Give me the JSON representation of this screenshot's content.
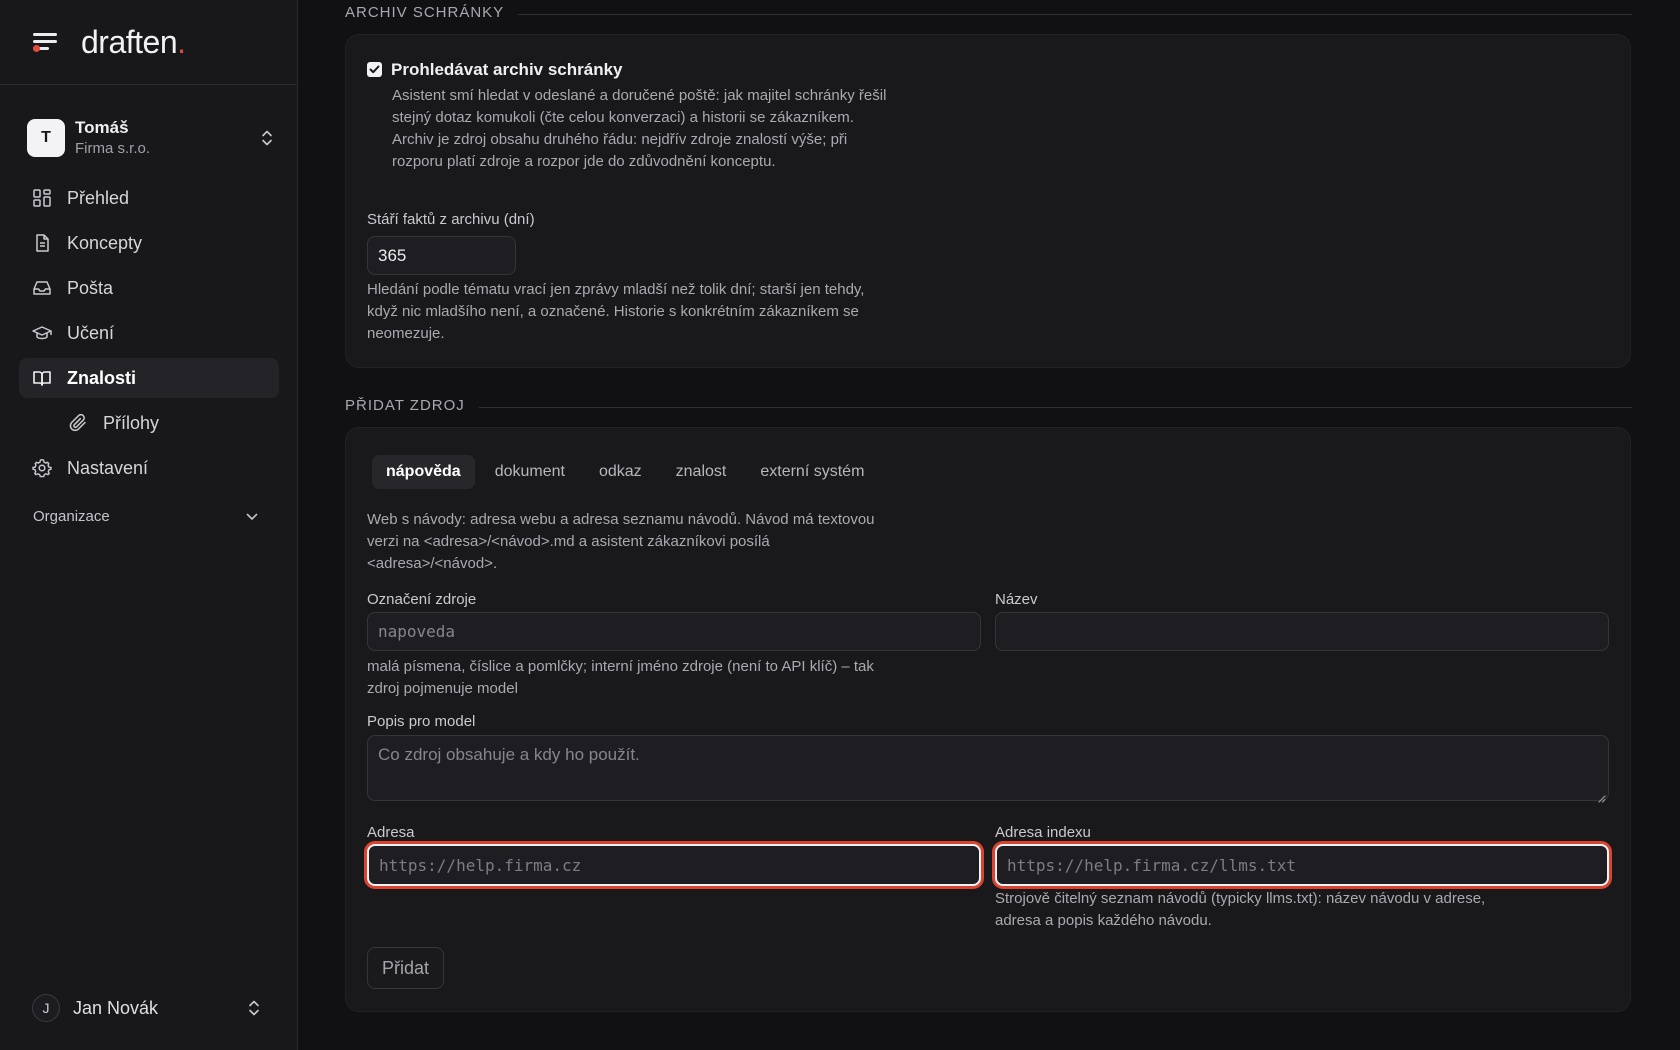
{
  "app": {
    "logo_text": "draften",
    "logo_dot": "."
  },
  "account": {
    "initial": "T",
    "name": "Tomáš",
    "company": "Firma s.r.o."
  },
  "nav": {
    "items": [
      {
        "label": "Přehled",
        "icon": "dashboard-grid-icon"
      },
      {
        "label": "Koncepty",
        "icon": "document-icon"
      },
      {
        "label": "Pošta",
        "icon": "inbox-tray-icon"
      },
      {
        "label": "Učení",
        "icon": "graduation-cap-icon"
      },
      {
        "label": "Znalosti",
        "icon": "open-book-icon",
        "active": true
      },
      {
        "label": "Přílohy",
        "icon": "paperclip-icon",
        "sub": true
      },
      {
        "label": "Nastavení",
        "icon": "gear-icon"
      }
    ],
    "organization": "Organizace"
  },
  "user": {
    "initial": "J",
    "name": "Jan Novák"
  },
  "archive": {
    "section_title": "ARCHIV SCHRÁNKY",
    "checkbox_label": "Prohledávat archiv schránky",
    "checkbox_checked": true,
    "checkbox_desc": "Asistent smí hledat v odeslané a doručené poště: jak majitel schránky řešil stejný dotaz komukoli (čte celou konverzaci) a historii se zákazníkem. Archiv je zdroj obsahu druhého řádu: nejdřív zdroje znalostí výše; při rozporu platí zdroje a rozpor jde do zdůvodnění konceptu.",
    "age_label": "Stáří faktů z archivu (dní)",
    "age_value": "365",
    "age_help": "Hledání podle tématu vrací jen zprávy mladší než tolik dní; starší jen tehdy, když nic mladšího není, a označené. Historie s konkrétním zákazníkem se neomezuje."
  },
  "add_source": {
    "section_title": "PŘIDAT ZDROJ",
    "tabs": [
      "nápověda",
      "dokument",
      "odkaz",
      "znalost",
      "externí systém"
    ],
    "active_tab": "nápověda",
    "intro": "Web s návody: adresa webu a adresa seznamu návodů. Návod má textovou verzi na <adresa>/<návod>.md a asistent zákazníkovi posílá <adresa>/<návod>.",
    "id_label": "Označení zdroje",
    "id_placeholder": "napoveda",
    "id_help": "malá písmena, číslice a pomlčky; interní jméno zdroje (není to API klíč) – tak zdroj pojmenuje model",
    "name_label": "Název",
    "name_value": "",
    "desc_label": "Popis pro model",
    "desc_placeholder": "Co zdroj obsahuje a kdy ho použít.",
    "url_label": "Adresa",
    "url_placeholder": "https://help.firma.cz",
    "index_label": "Adresa indexu",
    "index_placeholder": "https://help.firma.cz/llms.txt",
    "index_help": "Strojově čitelný seznam návodů (typicky llms.txt): název návodu v adrese, adresa a popis každého návodu.",
    "submit_label": "Přidat"
  },
  "colors": {
    "accent_red": "#e5483c",
    "background": "#111114",
    "sidebar": "#18181b",
    "card": "#19191c"
  }
}
